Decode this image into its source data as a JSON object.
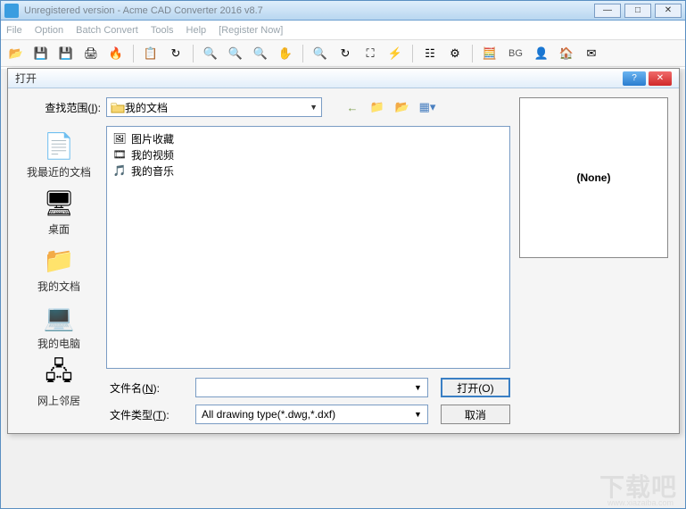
{
  "window": {
    "title": "Unregistered version - Acme CAD Converter 2016 v8.7"
  },
  "menubar": {
    "items": [
      "File",
      "Option",
      "Batch Convert",
      "Tools",
      "Help",
      "[Register Now]"
    ]
  },
  "toolbar": {
    "bg_label": "BG"
  },
  "dialog": {
    "title": "打开",
    "look_in_label": "查找范围(I):",
    "look_in_value": "我的文档",
    "places": {
      "recent": "我最近的文档",
      "desktop": "桌面",
      "documents": "我的文档",
      "computer": "我的电脑",
      "network": "网上邻居"
    },
    "files": {
      "items": [
        {
          "icon": "folder-pictures",
          "label": "图片收藏"
        },
        {
          "icon": "folder-video",
          "label": "我的视频"
        },
        {
          "icon": "folder-music",
          "label": "我的音乐"
        }
      ]
    },
    "filename_label": "文件名(N):",
    "filename_value": "",
    "filetype_label": "文件类型(T):",
    "filetype_value": "All drawing type(*.dwg,*.dxf)",
    "open_btn": "打开(O)",
    "cancel_btn": "取消",
    "preview_text": "(None)"
  },
  "watermark": {
    "text": "下载吧",
    "sub": "www.xiazaiba.com"
  }
}
